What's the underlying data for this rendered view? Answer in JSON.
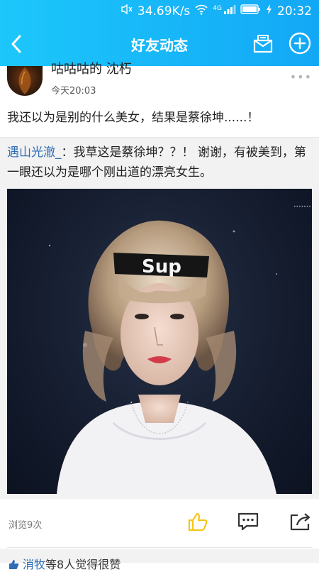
{
  "status_bar": {
    "speed": "34.69K/s",
    "network": "4G",
    "time": "20:32"
  },
  "header": {
    "title": "好友动态"
  },
  "post": {
    "username": "咕咕咕的 沈朽",
    "time": "今天20:03",
    "more": "•••",
    "content": "我还以为是别的什么美女，结果是蔡徐坤......！",
    "comment": {
      "author": "遇山光澈_",
      "text": "：我草这是蔡徐坤？？！ 谢谢，有被美到，第一眼还以为是哪个刚出道的漂亮女生。"
    },
    "photo_caption": "Sup"
  },
  "footer": {
    "views": "浏览9次",
    "likes_names": "消牧",
    "likes_text": "等8人觉得很赞"
  },
  "colors": {
    "header_start": "#1cc7fb",
    "header_end": "#13a8f6",
    "link_blue": "#2f6db5",
    "like_yellow": "#f5c518"
  }
}
